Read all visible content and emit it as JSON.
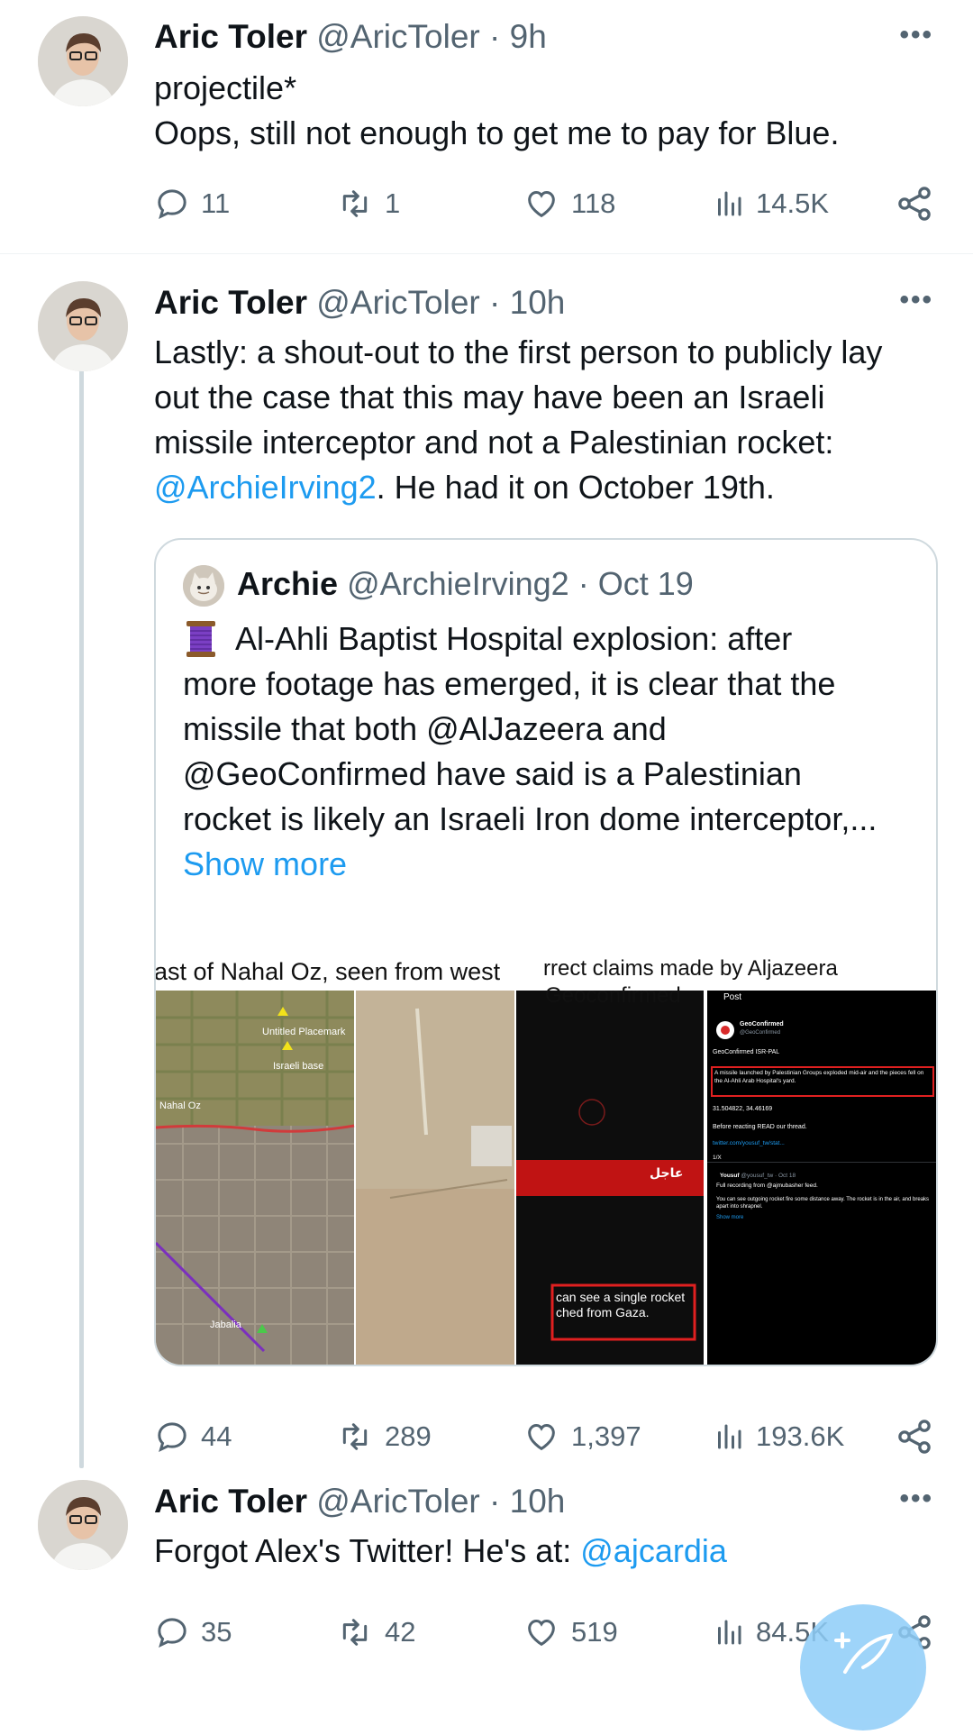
{
  "tweets": [
    {
      "name": "Aric Toler",
      "handle": "@AricToler",
      "time": "9h",
      "text_lines": [
        "projectile*",
        "Oops, still not enough to get me to pay for Blue."
      ],
      "stats": {
        "replies": "11",
        "retweets": "1",
        "likes": "118",
        "views": "14.5K"
      }
    },
    {
      "name": "Aric Toler",
      "handle": "@AricToler",
      "time": "10h",
      "text_lines": [
        "Lastly: a shout-out to the first person to publicly lay",
        "out the case that this may have been an Israeli",
        "missile interceptor and not a Palestinian rocket:"
      ],
      "mention": "@ArchieIrving2",
      "text_after_mention": ". He had it on October 19th.",
      "stats": {
        "replies": "44",
        "retweets": "289",
        "likes": "1,397",
        "views": "193.6K"
      }
    },
    {
      "name": "Aric Toler",
      "handle": "@AricToler",
      "time": "10h",
      "text": "Forgot Alex's Twitter! He's at: ",
      "mention": "@ajcardia",
      "stats": {
        "replies": "35",
        "retweets": "42",
        "likes": "519",
        "views": "84.5K"
      }
    }
  ],
  "quote": {
    "name": "Archie",
    "handle": "@ArchieIrving2",
    "time": "Oct 19",
    "text_lines": [
      "Al-Ahli Baptist Hospital explosion: after",
      "more footage has emerged, it is clear that the",
      "missile that both @AlJazeera and",
      "@GeoConfirmed have said is a Palestinian",
      "rocket is likely an Israeli Iron dome interceptor,..."
    ],
    "show_more": "Show more",
    "media": {
      "left_caption": "ast of Nahal Oz, seen from west",
      "right_caption_1": "rrect claims made by Aljazeera",
      "right_caption_2": "Geoconfirmed",
      "map_labels": [
        "Untitled Placemark",
        "Israeli base",
        "Nahal Oz",
        "Jabalia"
      ],
      "aj_caption_lines": [
        "can see a single rocket",
        "ched from Gaza."
      ],
      "aj_badge": "عاجل",
      "post_header": "Post",
      "post_account": "GeoConfirmed",
      "post_subhandle": "@GeoConfirmed",
      "post_tag": "GeoConfirmed ISR-PAL",
      "post_highlight": "A missile launched by Palestinian Groups exploded mid-air and the pieces fell on the Al-Ahli Arab Hospital's yard.",
      "post_coords": "31.504822, 34.46169",
      "post_read": "Before reacting READ our thread.",
      "post_link": "twitter.com/yousuf_tw/stat...",
      "post_count": "1/X",
      "post_reply_name": "Yousuf",
      "post_reply_meta": "@yousuf_tw · Oct 18",
      "post_reply_1": "Full recording from @ajmubasher feed.",
      "post_reply_2": "You can see outgoing rocket fire some distance away. The rocket is in the air, and breaks apart into shrapnel.",
      "post_show_more": "Show more"
    }
  },
  "colors": {
    "accent": "#1d9bf0",
    "muted": "#536471",
    "border": "#cfd9de"
  }
}
